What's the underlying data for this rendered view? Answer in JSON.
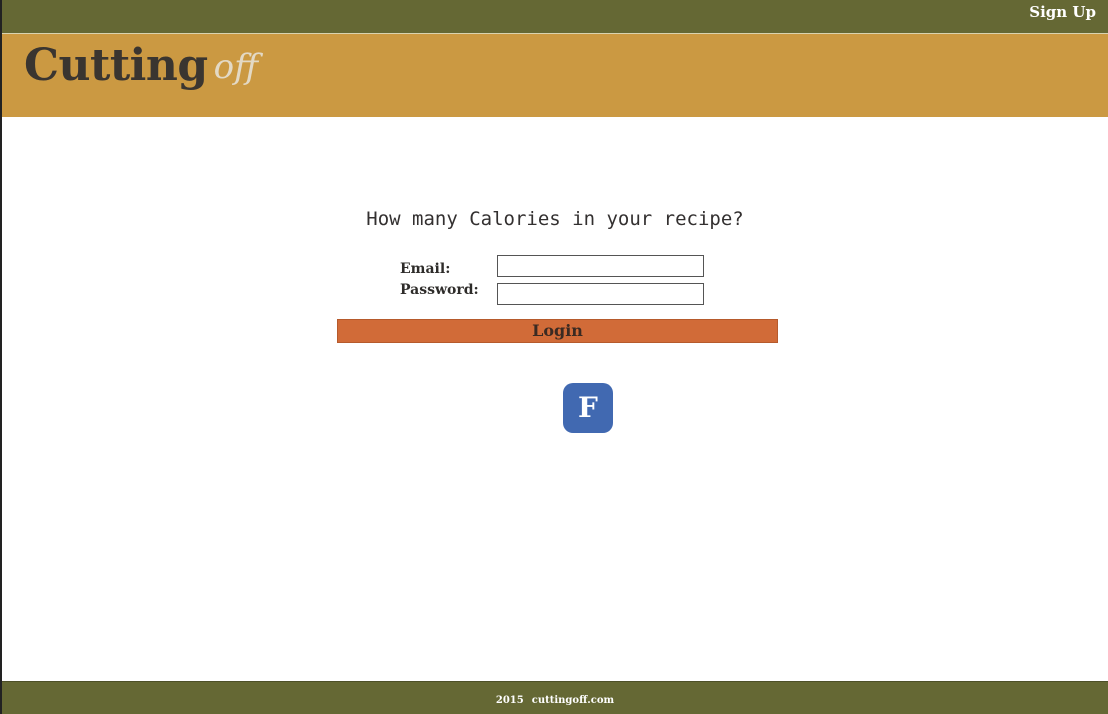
{
  "topbar": {
    "signup_label": "Sign Up"
  },
  "banner": {
    "logo_main": "Cutting",
    "logo_sub": "off"
  },
  "main": {
    "headline": "How many Calories in your recipe?",
    "email_label": "Email:",
    "email_value": "",
    "password_label": "Password:",
    "password_value": "",
    "login_label": "Login",
    "facebook_label": "F"
  },
  "footer": {
    "year": "2015",
    "site": "cuttingoff.com"
  },
  "colors": {
    "topbar": "#656834",
    "banner": "#cb9942",
    "login_button": "#d16b38",
    "facebook_button": "#4169b1",
    "footer": "#656834"
  },
  "icons": {
    "facebook": "facebook-icon"
  }
}
